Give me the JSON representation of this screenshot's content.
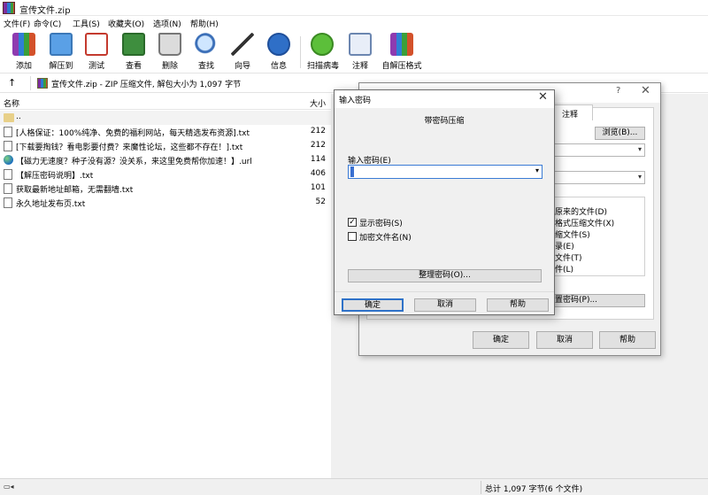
{
  "window": {
    "title": "宣传文件.zip"
  },
  "menu": [
    "文件(F)",
    "命令(C)",
    "工具(S)",
    "收藏夹(O)",
    "选项(N)",
    "帮助(H)"
  ],
  "toolbar": [
    {
      "label": "添加",
      "icon": "add-archive-icon"
    },
    {
      "label": "解压到",
      "icon": "extract-to-icon"
    },
    {
      "label": "测试",
      "icon": "test-icon"
    },
    {
      "label": "查看",
      "icon": "view-icon"
    },
    {
      "label": "删除",
      "icon": "delete-icon"
    },
    {
      "label": "查找",
      "icon": "find-icon"
    },
    {
      "label": "向导",
      "icon": "wizard-icon"
    },
    {
      "label": "信息",
      "icon": "info-icon"
    },
    {
      "label": "扫描病毒",
      "icon": "virus-scan-icon"
    },
    {
      "label": "注释",
      "icon": "comment-icon"
    },
    {
      "label": "自解压格式",
      "icon": "sfx-icon"
    }
  ],
  "address": {
    "path": "宣传文件.zip - ZIP 压缩文件, 解包大小为 1,097 字节"
  },
  "list": {
    "col_name": "名称",
    "col_size": "大小",
    "rows": [
      {
        "name": "..",
        "size": "",
        "type": "folder"
      },
      {
        "name": "[人格保证：100%纯净、免费的福利网站，每天精选发布资源].txt",
        "size": "212",
        "type": "txt"
      },
      {
        "name": "[下载要掏钱？看电影要付费？来魔性论坛，这些都不存在！].txt",
        "size": "212",
        "type": "txt"
      },
      {
        "name": "【磁力无速度？种子没有源？没关系，来这里免费帮你加速！】.url",
        "size": "114",
        "type": "url"
      },
      {
        "name": "【解压密码说明】.txt",
        "size": "406",
        "type": "txt"
      },
      {
        "name": "获取最新地址邮箱，无需翻墙.txt",
        "size": "101",
        "type": "txt"
      },
      {
        "name": "永久地址发布页.txt",
        "size": "52",
        "type": "txt"
      }
    ]
  },
  "status": {
    "summary": "总计 1,097 字节(6 个文件)"
  },
  "back_dialog": {
    "help_glyph": "?",
    "close_glyph": "✕",
    "tab_comment": "注释",
    "browse_button": "浏览(B)...",
    "options": [
      "原来的文件(D)",
      "格式压缩文件(X)",
      "缩文件(S)",
      "录(E)",
      "文件(T)",
      "件(L)"
    ],
    "set_password_button": "置密码(P)...",
    "ok": "确定",
    "cancel": "取消",
    "help": "帮助"
  },
  "password_dialog": {
    "title": "输入密码",
    "close_glyph": "✕",
    "subtitle": "带密码压缩",
    "field_label": "输入密码(E)",
    "password_value": "",
    "show_password_label": "显示密码(S)",
    "show_password_checked": true,
    "encrypt_names_label": "加密文件名(N)",
    "encrypt_names_checked": false,
    "organize_button": "整理密码(O)...",
    "ok": "确定",
    "cancel": "取消",
    "help": "帮助"
  }
}
